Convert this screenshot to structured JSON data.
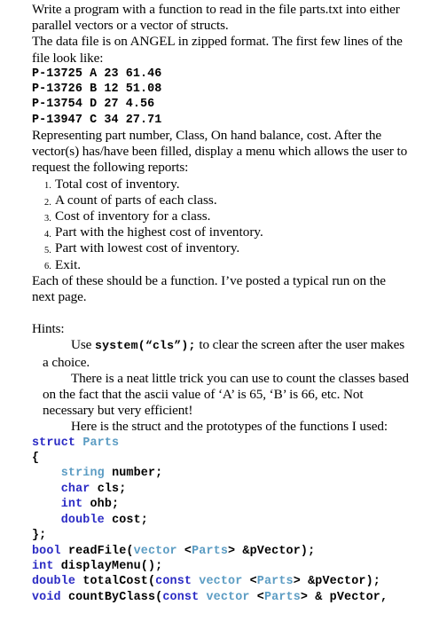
{
  "document": {
    "intro": [
      "Write a program with a function to read in the file parts.txt into either parallel vectors or a vector of structs.",
      "The data file is on ANGEL in zipped format.  The first few lines of the file look like:"
    ],
    "data_lines": [
      "P-13725 A 23 61.46",
      "P-13726 B 12 51.08",
      "P-13754 D 27 4.56",
      "P-13947 C 34 27.71"
    ],
    "after_data": "Representing part number, Class, On hand balance, cost.  After the vector(s) has/have been filled, display a menu which allows the user to request the following reports:",
    "report_list": [
      {
        "num": "1.",
        "text": "Total cost of inventory."
      },
      {
        "num": "2.",
        "text": "A count of parts of each class."
      },
      {
        "num": "3.",
        "text": "Cost of inventory for a class."
      },
      {
        "num": "4.",
        "text": "Part with the highest cost of inventory."
      },
      {
        "num": "5.",
        "text": "Part with lowest cost of inventory."
      },
      {
        "num": "6.",
        "text": "Exit."
      }
    ],
    "after_list": "Each of these should be a function. I’ve posted a typical run on the next page.",
    "hints_label": "Hints:",
    "hint_use_prefix": "Use ",
    "hint_use_code": "system(“cls”)",
    "hint_use_code_semi": ";",
    "hint_use_suffix": " to clear the screen after the user makes a choice.",
    "hint_ascii": "There is a neat little trick you can use to count the classes based on the fact that the ascii value of ‘A’ is 65, ‘B’ is 66, etc. Not necessary but very efficient!",
    "hint_struct_intro": "Here is the struct and the prototypes of the functions I used:",
    "code_lines": [
      [
        {
          "t": "struct ",
          "c": "kw"
        },
        {
          "t": "Parts",
          "c": "typ"
        }
      ],
      [
        {
          "t": "{",
          "c": "pln"
        }
      ],
      [
        {
          "t": "    ",
          "c": "pln"
        },
        {
          "t": "string ",
          "c": "typ"
        },
        {
          "t": "number;",
          "c": "pln"
        }
      ],
      [
        {
          "t": "    ",
          "c": "pln"
        },
        {
          "t": "char ",
          "c": "kw"
        },
        {
          "t": "cls;",
          "c": "pln"
        }
      ],
      [
        {
          "t": "    ",
          "c": "pln"
        },
        {
          "t": "int ",
          "c": "kw"
        },
        {
          "t": "ohb;",
          "c": "pln"
        }
      ],
      [
        {
          "t": "    ",
          "c": "pln"
        },
        {
          "t": "double ",
          "c": "kw"
        },
        {
          "t": "cost;",
          "c": "pln"
        }
      ],
      [
        {
          "t": "};",
          "c": "pln"
        }
      ],
      [
        {
          "t": "bool ",
          "c": "kw"
        },
        {
          "t": "readFile(",
          "c": "pln"
        },
        {
          "t": "vector ",
          "c": "typ"
        },
        {
          "t": "<",
          "c": "pln"
        },
        {
          "t": "Parts",
          "c": "typ"
        },
        {
          "t": "> &pVector);",
          "c": "pln"
        }
      ],
      [
        {
          "t": "int ",
          "c": "kw"
        },
        {
          "t": "displayMenu();",
          "c": "pln"
        }
      ],
      [
        {
          "t": "double ",
          "c": "kw"
        },
        {
          "t": "totalCost(",
          "c": "pln"
        },
        {
          "t": "const ",
          "c": "kw"
        },
        {
          "t": "vector ",
          "c": "typ"
        },
        {
          "t": "<",
          "c": "pln"
        },
        {
          "t": "Parts",
          "c": "typ"
        },
        {
          "t": "> &pVector);",
          "c": "pln"
        }
      ],
      [
        {
          "t": "void ",
          "c": "kw"
        },
        {
          "t": "countByClass(",
          "c": "pln"
        },
        {
          "t": "const ",
          "c": "kw"
        },
        {
          "t": "vector ",
          "c": "typ"
        },
        {
          "t": "<",
          "c": "pln"
        },
        {
          "t": "Parts",
          "c": "typ"
        },
        {
          "t": "> & pVector,",
          "c": "pln"
        }
      ]
    ]
  },
  "colors": {
    "keyword": "#2a2ac4",
    "type": "#5b9cc3",
    "plain": "#000000",
    "background": "#ffffff"
  }
}
